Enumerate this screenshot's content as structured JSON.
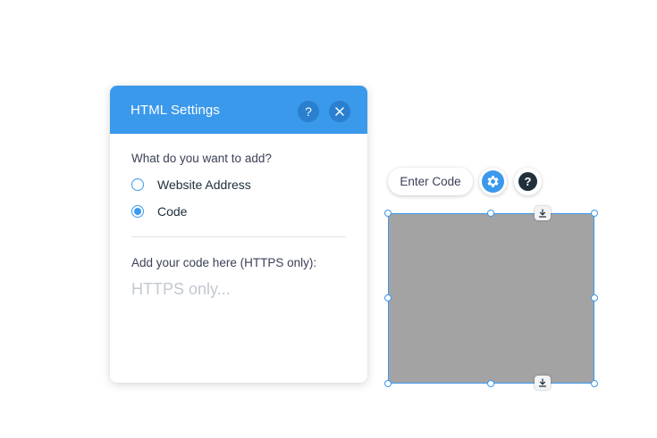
{
  "panel": {
    "title": "HTML Settings",
    "help_icon": "question-mark-icon",
    "close_icon": "close-icon",
    "question": "What do you want to add?",
    "options": [
      {
        "label": "Website Address",
        "selected": false
      },
      {
        "label": "Code",
        "selected": true
      }
    ],
    "code_label": "Add your code here (HTTPS only):",
    "code_placeholder": "HTTPS only...",
    "code_value": ""
  },
  "toolbar": {
    "enter_code_label": "Enter Code",
    "settings_icon": "gear-icon",
    "help_icon": "question-mark-icon",
    "help_glyph": "?"
  },
  "element": {
    "fill_color": "#a3a3a3",
    "selection_color": "#3b99ec",
    "stretch_icon": "download-arrow-icon"
  },
  "colors": {
    "accent": "#3b99ec",
    "header_button": "#2a7fcf",
    "text_dark": "#20303c",
    "text_muted": "#3b4057",
    "placeholder": "#c3c8d0"
  }
}
